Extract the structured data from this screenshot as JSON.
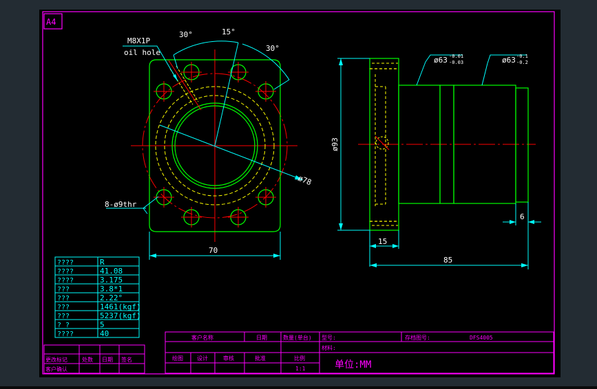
{
  "sheet": {
    "size_label": "A4"
  },
  "colors": {
    "frame": "#ff00ff",
    "outline": "#00ff00",
    "center": "#ff0000",
    "hidden": "#ffff00",
    "dimension": "#00ffff",
    "paper": "#000000",
    "viewport": "#232c33"
  },
  "annotations": {
    "thread_callout": "M8X1P",
    "oil_hole": "oil hole",
    "angle_left": "30°",
    "angle_top": "15°",
    "angle_right": "30°",
    "bolt_holes": "8-ø9thr",
    "pcd": "ø78",
    "width_front": "70",
    "dia_flange": "ø93",
    "dia_a": "ø63",
    "dia_a_tol_upper": "-0.01",
    "dia_a_tol_lower": "-0.03",
    "dia_b": "ø63",
    "dia_b_tol_upper": "-0.1",
    "dia_b_tol_lower": "-0.2",
    "flange_thickness": "15",
    "length_total": "85",
    "step_length": "6"
  },
  "spec_table": [
    {
      "label": "????",
      "value": "R"
    },
    {
      "label": "????",
      "value": "41.08"
    },
    {
      "label": "????",
      "value": "3.175"
    },
    {
      "label": "???",
      "value": "3.8*1"
    },
    {
      "label": "???",
      "value": "2.22°"
    },
    {
      "label": "???",
      "value": "1461(kgf)"
    },
    {
      "label": "???",
      "value": "5237(kgf)"
    },
    {
      "label": "? ?",
      "value": "5"
    },
    {
      "label": "????",
      "value": "40"
    }
  ],
  "revision_block": {
    "change_mark": "更改标记",
    "location": "处数",
    "date": "日期",
    "signature": "签名",
    "client_confirm": "客户确认"
  },
  "title_block": {
    "client_name": "客户名称",
    "date": "日期",
    "quantity": "数量(单台)",
    "model_label": "型号:",
    "drawing_no_label": "存档图号:",
    "drawing_no": "DFS4005",
    "material_label": "材料:",
    "drawn": "绘图",
    "designed": "设计",
    "checked": "审核",
    "approved": "批准",
    "scale_label": "比例",
    "scale": "1:1",
    "unit": "单位:MM"
  }
}
